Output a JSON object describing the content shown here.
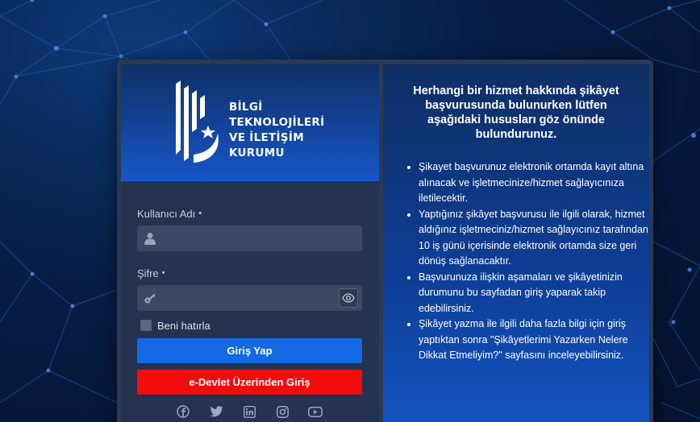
{
  "logo": {
    "lines": [
      "BİLGİ",
      "TEKNOLOJİLERİ",
      "VE İLETİŞİM",
      "KURUMU"
    ]
  },
  "form": {
    "username_label": "Kullanıcı Adı",
    "password_label": "Şifre",
    "required_marker": "•",
    "username_value": "",
    "password_value": "",
    "remember_label": "Beni hatırla",
    "remember_checked": false,
    "login_button": "Giriş Yap",
    "edevlet_button": "e-Devlet Üzerinden Giriş"
  },
  "social": {
    "icons": [
      "facebook-icon",
      "twitter-icon",
      "linkedin-icon",
      "instagram-icon",
      "youtube-icon"
    ]
  },
  "info": {
    "title": "Herhangi bir hizmet hakkında şikâyet başvurusunda bulunurken lütfen aşağıdaki hususları göz önünde bulundurunuz.",
    "items": [
      "Şikayet başvurunuz elektronik ortamda kayıt altına alınacak ve işletmecinize/hizmet sağlayıcınıza iletilecektir.",
      "Yaptığınız şikâyet başvurusu ile ilgili olarak, hizmet aldığınız işletmeciniz/hizmet sağlayıcınız tarafından 10 iş günü içerisinde elektronik ortamda size geri dönüş sağlanacaktır.",
      "Başvurunuza ilişkin aşamaları ve şikâyetinizin durumunu bu sayfadan giriş yaparak takip edebilirsiniz.",
      "Şikâyet yazma ile ilgili daha fazla bilgi için giriş yaptıktan sonra \"Şikâyetlerimi Yazarken Nelere Dikkat Etmeliyim?\" sayfasını inceleyebilirsiniz."
    ]
  },
  "colors": {
    "login_button": "#1468e3",
    "edevlet_button": "#f20d0d",
    "panel_bg": "#233350",
    "input_bg": "#3a4963"
  }
}
